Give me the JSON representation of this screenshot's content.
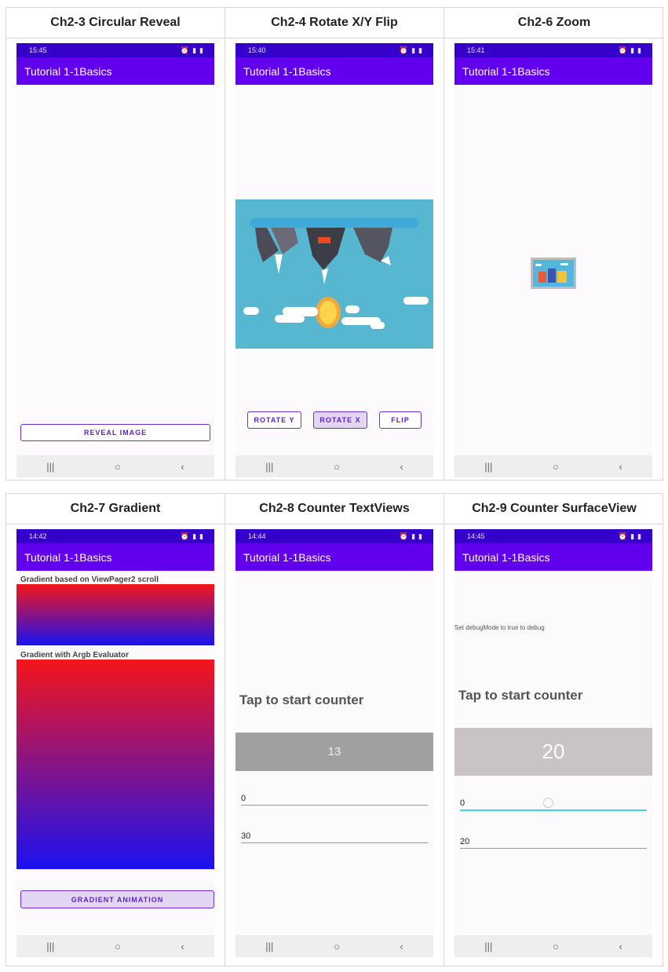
{
  "panels": [
    {
      "title": "Ch2-3 Circular Reveal",
      "time": "15:45",
      "app_title": "Tutorial 1-1Basics",
      "button": "REVEAL IMAGE"
    },
    {
      "title": "Ch2-4 Rotate X/Y Flip",
      "time": "15:40",
      "app_title": "Tutorial 1-1Basics",
      "buttons": [
        "ROTATE Y",
        "ROTATE X",
        "FLIP"
      ]
    },
    {
      "title": "Ch2-6 Zoom",
      "time": "15:41",
      "app_title": "Tutorial 1-1Basics"
    },
    {
      "title": "Ch2-7 Gradient",
      "time": "14:42",
      "app_title": "Tutorial 1-1Basics",
      "label1": "Gradient based on ViewPager2 scroll",
      "label2": "Gradient with Argb Evaluator",
      "button": "GRADIENT ANIMATION"
    },
    {
      "title": "Ch2-8 Counter TextViews",
      "time": "14:44",
      "app_title": "Tutorial 1-1Basics",
      "prompt": "Tap to start counter",
      "counter": "13",
      "field1": "0",
      "field2": "30"
    },
    {
      "title": "Ch2-9 Counter SurfaceView",
      "time": "14:45",
      "app_title": "Tutorial 1-1Basics",
      "debug_text": "Set debugMode to true to debug",
      "prompt": "Tap to start counter",
      "counter": "20",
      "field1": "0",
      "field2": "20"
    }
  ],
  "nav_icons": [
    "recents-icon",
    "home-icon",
    "back-icon"
  ],
  "colors": {
    "status_bar": "#3500c9",
    "app_bar": "#6200ee",
    "accent": "#6a2fd8"
  }
}
